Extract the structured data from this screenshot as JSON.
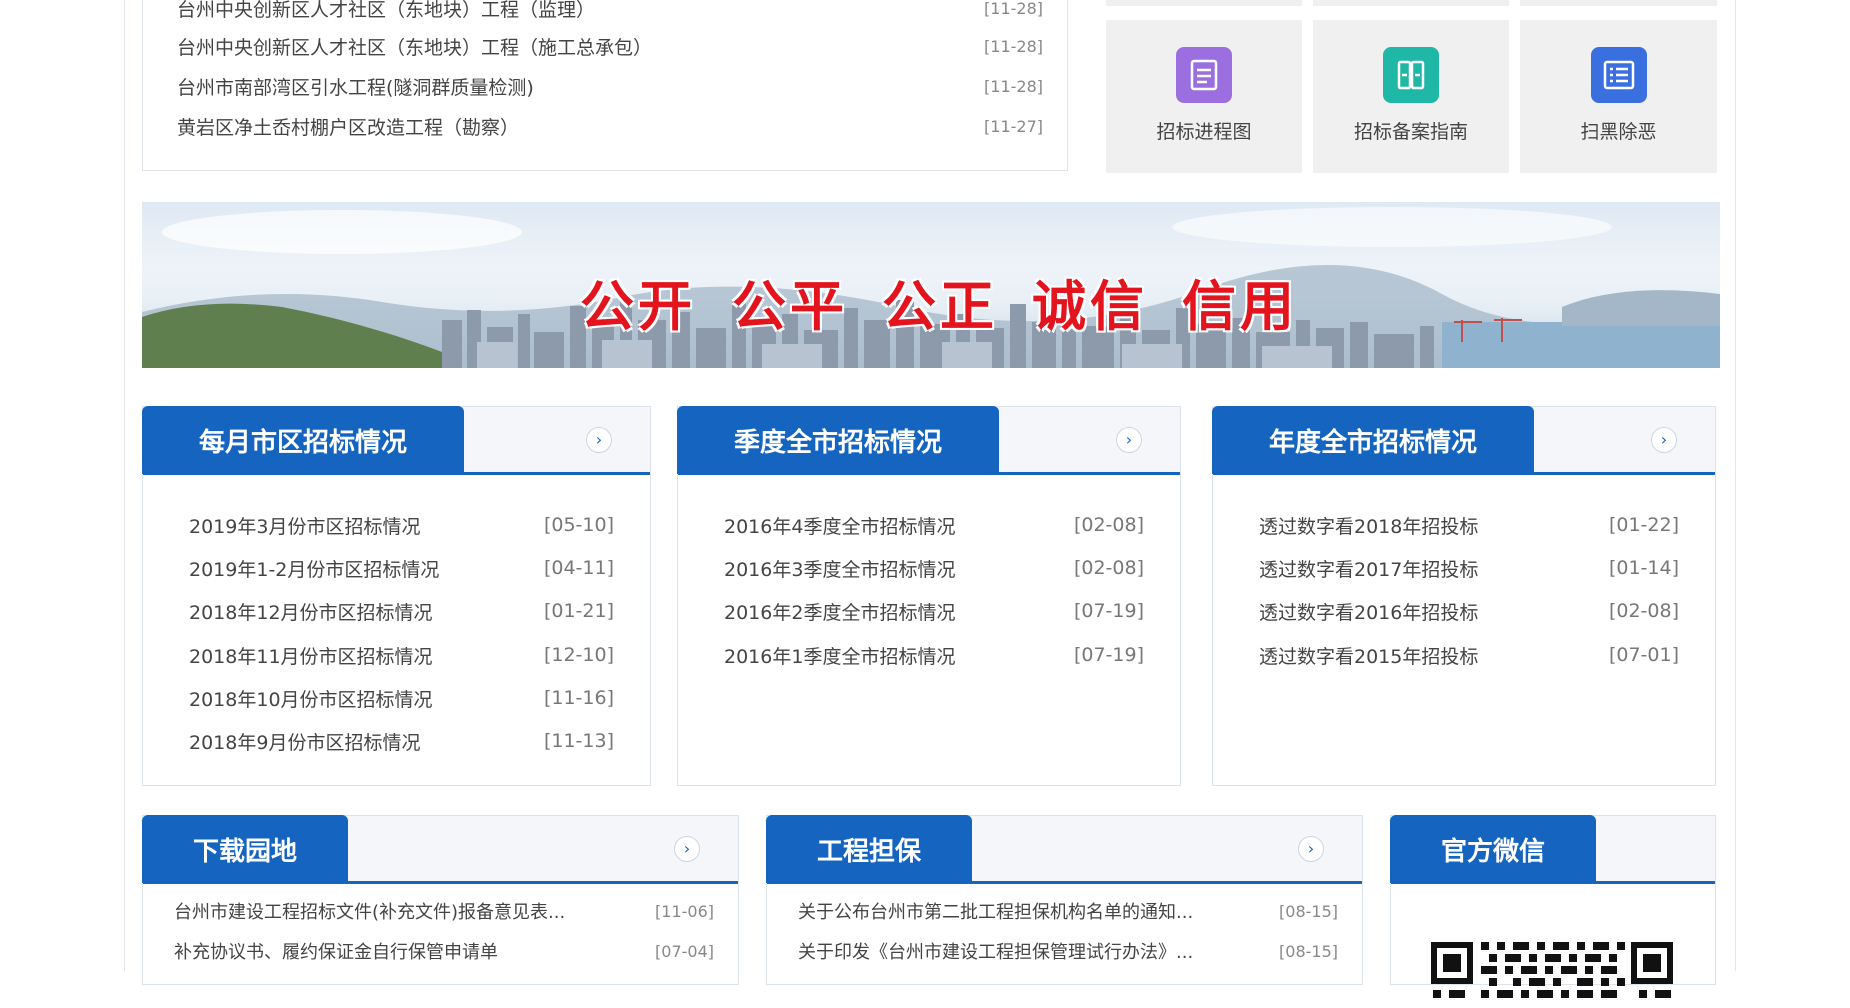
{
  "top_news": [
    {
      "title": "台州中央创新区人才社区（东地块）工程（监理）",
      "date": "[11-28]"
    },
    {
      "title": "台州中央创新区人才社区（东地块）工程（施工总承包）",
      "date": "[11-28]"
    },
    {
      "title": "台州市南部湾区引水工程(隧洞群质量检测)",
      "date": "[11-28]"
    },
    {
      "title": "黄岩区净土岙村棚户区改造工程（勘察）",
      "date": "[11-27]"
    }
  ],
  "quick_links": [
    {
      "label": "招标进程图",
      "icon": "document-icon",
      "color": "#9b6fe0"
    },
    {
      "label": "招标备案指南",
      "icon": "book-icon",
      "color": "#1fb7a6"
    },
    {
      "label": "扫黑除恶",
      "icon": "list-icon",
      "color": "#3a6fe0"
    }
  ],
  "banner": {
    "slogans": [
      "公开",
      "公平",
      "公正",
      "诚信",
      "信用"
    ]
  },
  "panels": [
    {
      "title": "每月市区招标情况",
      "more": "›",
      "items": [
        {
          "title": "2019年3月份市区招标情况",
          "date": "[05-10]"
        },
        {
          "title": "2019年1-2月份市区招标情况",
          "date": "[04-11]"
        },
        {
          "title": "2018年12月份市区招标情况",
          "date": "[01-21]"
        },
        {
          "title": "2018年11月份市区招标情况",
          "date": "[12-10]"
        },
        {
          "title": "2018年10月份市区招标情况",
          "date": "[11-16]"
        },
        {
          "title": "2018年9月份市区招标情况",
          "date": "[11-13]"
        }
      ]
    },
    {
      "title": "季度全市招标情况",
      "more": "›",
      "items": [
        {
          "title": "2016年4季度全市招标情况",
          "date": "[02-08]"
        },
        {
          "title": "2016年3季度全市招标情况",
          "date": "[02-08]"
        },
        {
          "title": "2016年2季度全市招标情况",
          "date": "[07-19]"
        },
        {
          "title": "2016年1季度全市招标情况",
          "date": "[07-19]"
        }
      ]
    },
    {
      "title": "年度全市招标情况",
      "more": "›",
      "items": [
        {
          "title": "透过数字看2018年招投标",
          "date": "[01-22]"
        },
        {
          "title": "透过数字看2017年招投标",
          "date": "[01-14]"
        },
        {
          "title": "透过数字看2016年招投标",
          "date": "[02-08]"
        },
        {
          "title": "透过数字看2015年招投标",
          "date": "[07-01]"
        }
      ]
    }
  ],
  "bottom_panels": [
    {
      "title": "下载园地",
      "more": "›",
      "items": [
        {
          "title": "台州市建设工程招标文件(补充文件)报备意见表...",
          "date": "[11-06]"
        },
        {
          "title": "补充协议书、履约保证金自行保管申请单",
          "date": "[07-04]"
        }
      ]
    },
    {
      "title": "工程担保",
      "more": "›",
      "items": [
        {
          "title": "关于公布台州市第二批工程担保机构名单的通知...",
          "date": "[08-15]"
        },
        {
          "title": "关于印发《台州市建设工程担保管理试行办法》...",
          "date": "[08-15]"
        }
      ]
    },
    {
      "title": "官方微信"
    }
  ],
  "colors": {
    "primary_blue": "#1565c0",
    "slogan_red": "#e3141d"
  }
}
